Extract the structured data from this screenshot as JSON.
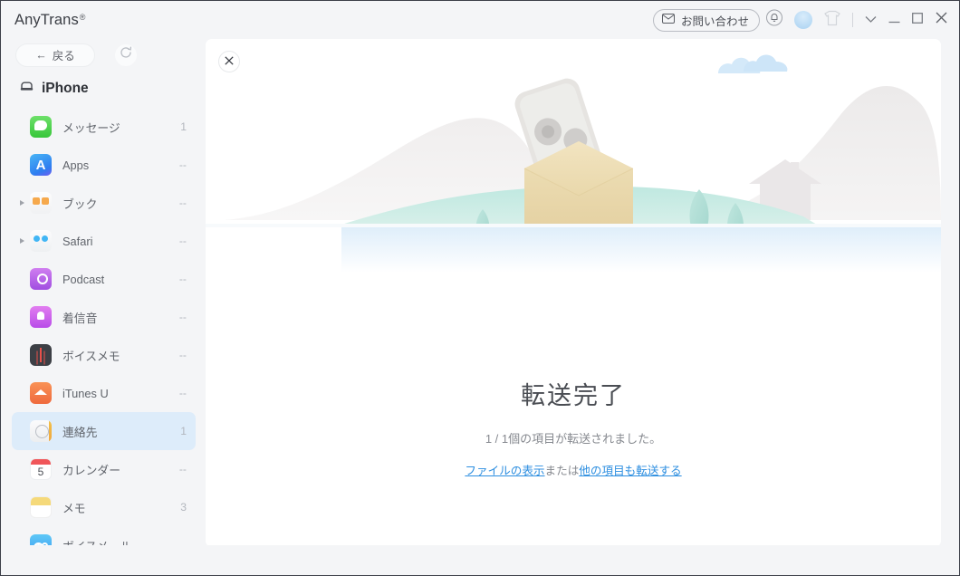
{
  "window": {
    "brand": "AnyTrans",
    "brand_mark": "®",
    "contact_label": "お問い合わせ",
    "icons": {
      "envelope": "envelope-icon",
      "bell": "bell-icon",
      "avatar": "avatar",
      "skin": "skin-icon",
      "chevron_down": "chevron-down-icon",
      "minimize": "minimize-icon",
      "maximize": "maximize-icon",
      "close": "close-icon"
    }
  },
  "sidebar": {
    "back_label": "戻る",
    "back_arrow": "←",
    "refresh_icon": "refresh-icon",
    "device_name": "iPhone",
    "device_icon": "device-icon",
    "items": [
      {
        "label": "メッセージ",
        "count": "1",
        "icon": "messages-icon",
        "expandable": false,
        "selected": false
      },
      {
        "label": "Apps",
        "count": "--",
        "icon": "apps-icon",
        "expandable": false,
        "selected": false
      },
      {
        "label": "ブック",
        "count": "--",
        "icon": "books-icon",
        "expandable": true,
        "selected": false
      },
      {
        "label": "Safari",
        "count": "--",
        "icon": "safari-icon",
        "expandable": true,
        "selected": false
      },
      {
        "label": "Podcast",
        "count": "--",
        "icon": "podcast-icon",
        "expandable": false,
        "selected": false
      },
      {
        "label": "着信音",
        "count": "--",
        "icon": "ringtone-icon",
        "expandable": false,
        "selected": false
      },
      {
        "label": "ボイスメモ",
        "count": "--",
        "icon": "voicememo-icon",
        "expandable": false,
        "selected": false
      },
      {
        "label": "iTunes U",
        "count": "--",
        "icon": "itunesu-icon",
        "expandable": false,
        "selected": false
      },
      {
        "label": "連絡先",
        "count": "1",
        "icon": "contacts-icon",
        "expandable": false,
        "selected": true
      },
      {
        "label": "カレンダー",
        "count": "--",
        "icon": "calendar-icon",
        "expandable": false,
        "selected": false,
        "icon_text": "5"
      },
      {
        "label": "メモ",
        "count": "3",
        "icon": "notes-icon",
        "expandable": false,
        "selected": false
      },
      {
        "label": "ボイスメール",
        "count": "--",
        "icon": "voicemail-icon",
        "expandable": false,
        "selected": false
      }
    ]
  },
  "main": {
    "close_icon": "close-icon",
    "headline": "転送完了",
    "subline": "1 / 1個の項目が転送されました。",
    "link_view_files": "ファイルの表示",
    "link_separator": "または",
    "link_transfer_more": "他の項目も転送する",
    "illustration": "transfer-complete-illustration"
  },
  "colors": {
    "accent_link": "#2c8ee0",
    "selected_row": "#ddecfa",
    "sidebar_bg": "#f4f5f7",
    "panel_bg": "#ffffff",
    "box_tan": "#e8d6a9",
    "tree_mint": "#a9dbd2",
    "cloud_blue": "#cfe6f8"
  }
}
